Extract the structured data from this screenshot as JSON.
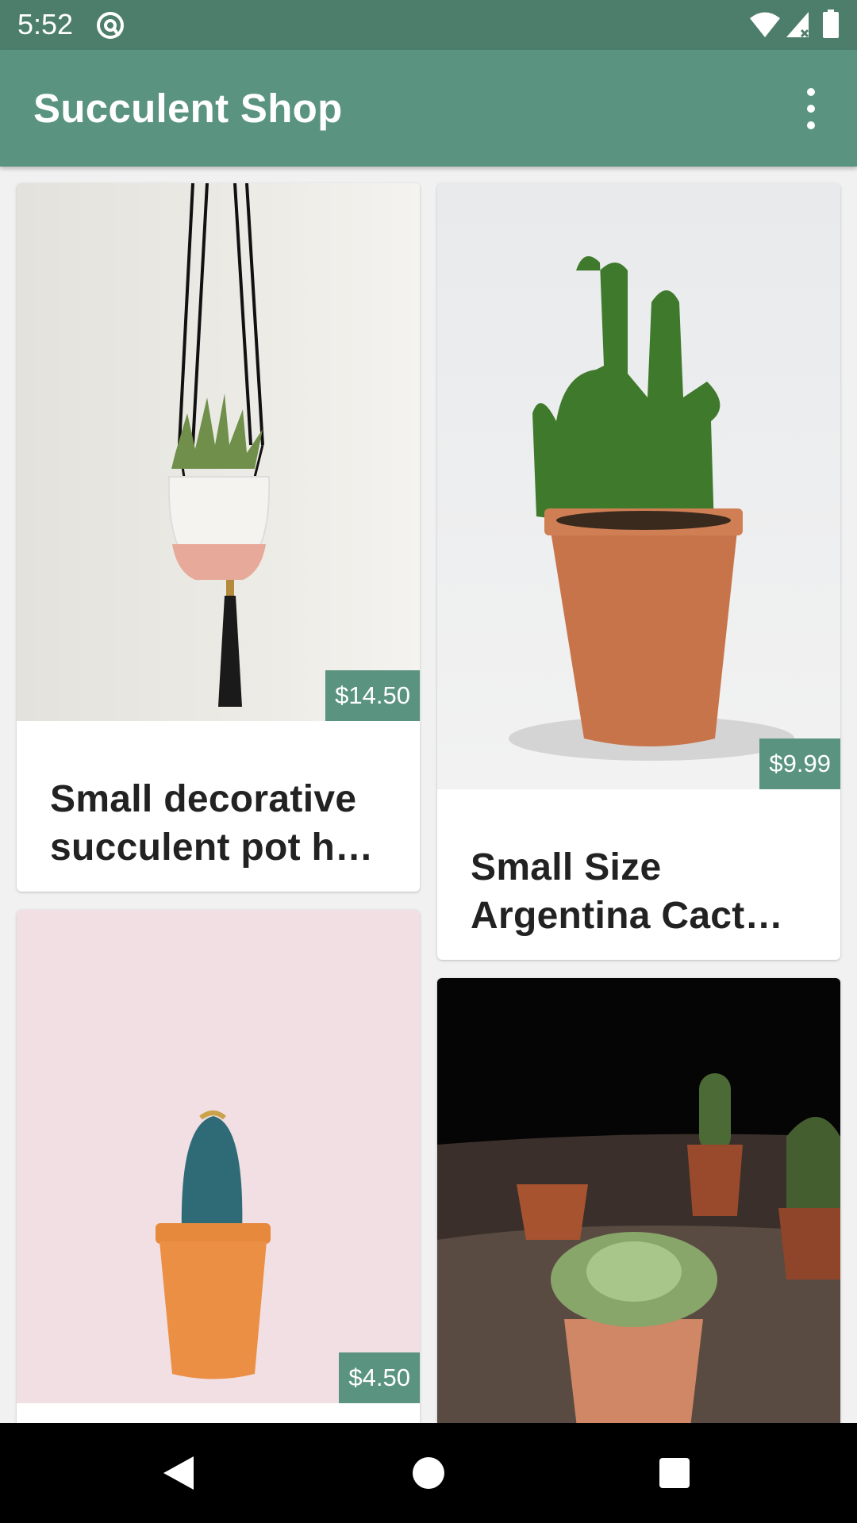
{
  "status_bar": {
    "time": "5:52",
    "icons": [
      "at-sign-app-icon",
      "wifi-icon",
      "signal-icon",
      "battery-icon"
    ]
  },
  "app_bar": {
    "title": "Succulent Shop",
    "menu_icon": "more-vert-icon"
  },
  "products": [
    {
      "name_line1": "Small decorative",
      "name_line2": "succulent pot h…",
      "price": "$14.50"
    },
    {
      "name_line1": "Small Size",
      "name_line2": "Argentina Cact…",
      "price": "$9.99"
    },
    {
      "name_line1": "",
      "name_line2": "",
      "price": "$4.50"
    },
    {
      "name_line1": "",
      "name_line2": "",
      "price": ""
    }
  ],
  "colors": {
    "status_bar": "#4d7e6c",
    "primary": "#5a9480",
    "background": "#f1f1f1"
  },
  "nav_bar": {
    "icons": [
      "back-icon",
      "home-icon",
      "recents-icon"
    ]
  }
}
